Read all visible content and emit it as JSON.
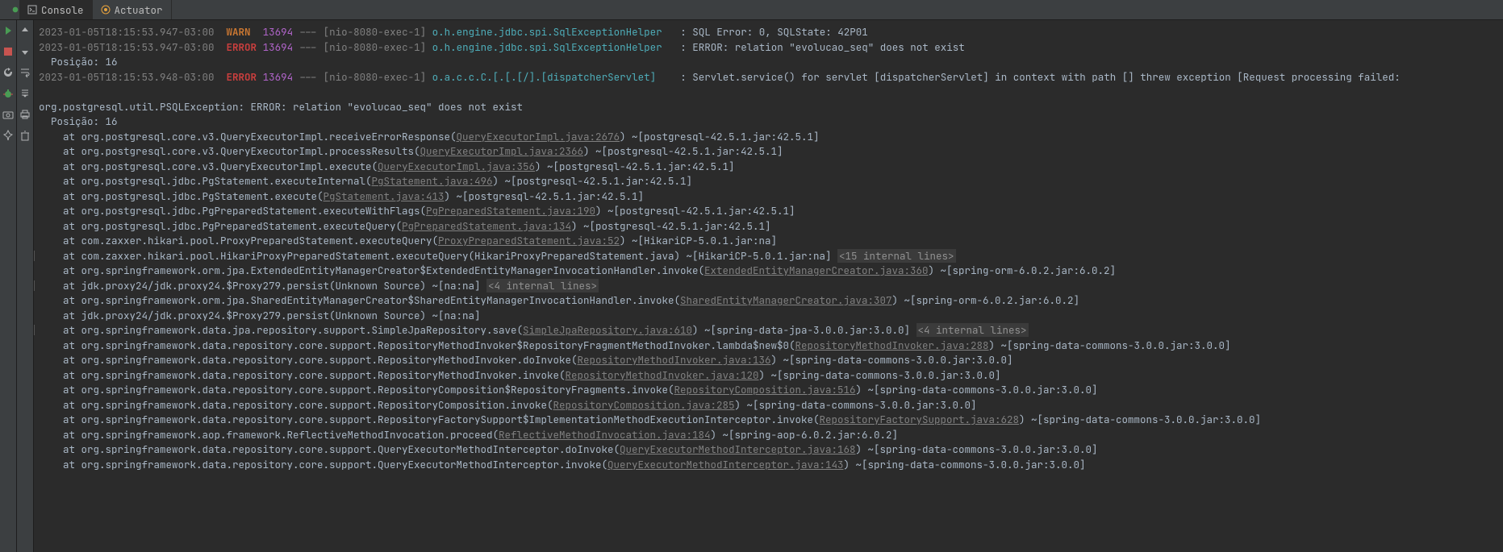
{
  "tabs": [
    {
      "label": "Console",
      "active": true,
      "icon": "terminal"
    },
    {
      "label": "Actuator",
      "active": false,
      "icon": "actuator"
    }
  ],
  "log": [
    {
      "type": "header",
      "ts": "2023-01-05T18:15:53.947-03:00",
      "level": "WARN",
      "levelClass": "warn",
      "pid": "13694",
      "thread": "[nio-8080-exec-1]",
      "logger": "o.h.engine.jdbc.spi.SqlExceptionHelper",
      "msg": ": SQL Error: 0, SQLState: 42P01"
    },
    {
      "type": "header",
      "ts": "2023-01-05T18:15:53.947-03:00",
      "level": "ERROR",
      "levelClass": "err",
      "pid": "13694",
      "thread": "[nio-8080-exec-1]",
      "logger": "o.h.engine.jdbc.spi.SqlExceptionHelper",
      "msg": ": ERROR: relation \"evolucao_seq\" does not exist"
    },
    {
      "type": "plain",
      "text": "  Posição: 16"
    },
    {
      "type": "header",
      "ts": "2023-01-05T18:15:53.948-03:00",
      "level": "ERROR",
      "levelClass": "err",
      "pid": "13694",
      "thread": "[nio-8080-exec-1]",
      "logger": "o.a.c.c.C.[.[.[/].[dispatcherServlet]",
      "msg": ": Servlet.service() for servlet [dispatcherServlet] in context with path [] threw exception [Request processing failed:"
    },
    {
      "type": "blank"
    },
    {
      "type": "plain",
      "text": "org.postgresql.util.PSQLException: ERROR: relation \"evolucao_seq\" does not exist"
    },
    {
      "type": "plain",
      "text": "  Posição: 16"
    },
    {
      "type": "trace",
      "pre": "    at org.postgresql.core.v3.QueryExecutorImpl.receiveErrorResponse(",
      "link": "QueryExecutorImpl.java:2676",
      "post": ") ~[postgresql-42.5.1.jar:42.5.1]"
    },
    {
      "type": "trace",
      "pre": "    at org.postgresql.core.v3.QueryExecutorImpl.processResults(",
      "link": "QueryExecutorImpl.java:2366",
      "post": ") ~[postgresql-42.5.1.jar:42.5.1]"
    },
    {
      "type": "trace",
      "pre": "    at org.postgresql.core.v3.QueryExecutorImpl.execute(",
      "link": "QueryExecutorImpl.java:356",
      "post": ") ~[postgresql-42.5.1.jar:42.5.1]"
    },
    {
      "type": "trace",
      "pre": "    at org.postgresql.jdbc.PgStatement.executeInternal(",
      "link": "PgStatement.java:496",
      "post": ") ~[postgresql-42.5.1.jar:42.5.1]"
    },
    {
      "type": "trace",
      "pre": "    at org.postgresql.jdbc.PgStatement.execute(",
      "link": "PgStatement.java:413",
      "post": ") ~[postgresql-42.5.1.jar:42.5.1]"
    },
    {
      "type": "trace",
      "pre": "    at org.postgresql.jdbc.PgPreparedStatement.executeWithFlags(",
      "link": "PgPreparedStatement.java:190",
      "post": ") ~[postgresql-42.5.1.jar:42.5.1]"
    },
    {
      "type": "trace",
      "pre": "    at org.postgresql.jdbc.PgPreparedStatement.executeQuery(",
      "link": "PgPreparedStatement.java:134",
      "post": ") ~[postgresql-42.5.1.jar:42.5.1]"
    },
    {
      "type": "trace",
      "pre": "    at com.zaxxer.hikari.pool.ProxyPreparedStatement.executeQuery(",
      "link": "ProxyPreparedStatement.java:52",
      "post": ") ~[HikariCP-5.0.1.jar:na]"
    },
    {
      "type": "trace",
      "fold": true,
      "pre": "    at com.zaxxer.hikari.pool.HikariProxyPreparedStatement.executeQuery(HikariProxyPreparedStatement.java) ~[HikariCP-5.0.1.jar:na] ",
      "internal": "<15 internal lines>"
    },
    {
      "type": "trace",
      "pre": "    at org.springframework.orm.jpa.ExtendedEntityManagerCreator$ExtendedEntityManagerInvocationHandler.invoke(",
      "link": "ExtendedEntityManagerCreator.java:360",
      "post": ") ~[spring-orm-6.0.2.jar:6.0.2]"
    },
    {
      "type": "trace",
      "fold": true,
      "pre": "    at jdk.proxy24/jdk.proxy24.$Proxy279.persist(Unknown Source) ~[na:na] ",
      "internal": "<4 internal lines>"
    },
    {
      "type": "trace",
      "pre": "    at org.springframework.orm.jpa.SharedEntityManagerCreator$SharedEntityManagerInvocationHandler.invoke(",
      "link": "SharedEntityManagerCreator.java:307",
      "post": ") ~[spring-orm-6.0.2.jar:6.0.2]"
    },
    {
      "type": "plain",
      "text": "    at jdk.proxy24/jdk.proxy24.$Proxy279.persist(Unknown Source) ~[na:na]"
    },
    {
      "type": "trace",
      "fold": true,
      "pre": "    at org.springframework.data.jpa.repository.support.SimpleJpaRepository.save(",
      "link": "SimpleJpaRepository.java:610",
      "post": ") ~[spring-data-jpa-3.0.0.jar:3.0.0] ",
      "internal": "<4 internal lines>"
    },
    {
      "type": "trace",
      "pre": "    at org.springframework.data.repository.core.support.RepositoryMethodInvoker$RepositoryFragmentMethodInvoker.lambda$new$0(",
      "link": "RepositoryMethodInvoker.java:288",
      "post": ") ~[spring-data-commons-3.0.0.jar:3.0.0]"
    },
    {
      "type": "trace",
      "pre": "    at org.springframework.data.repository.core.support.RepositoryMethodInvoker.doInvoke(",
      "link": "RepositoryMethodInvoker.java:136",
      "post": ") ~[spring-data-commons-3.0.0.jar:3.0.0]"
    },
    {
      "type": "trace",
      "pre": "    at org.springframework.data.repository.core.support.RepositoryMethodInvoker.invoke(",
      "link": "RepositoryMethodInvoker.java:120",
      "post": ") ~[spring-data-commons-3.0.0.jar:3.0.0]"
    },
    {
      "type": "trace",
      "pre": "    at org.springframework.data.repository.core.support.RepositoryComposition$RepositoryFragments.invoke(",
      "link": "RepositoryComposition.java:516",
      "post": ") ~[spring-data-commons-3.0.0.jar:3.0.0]"
    },
    {
      "type": "trace",
      "pre": "    at org.springframework.data.repository.core.support.RepositoryComposition.invoke(",
      "link": "RepositoryComposition.java:285",
      "post": ") ~[spring-data-commons-3.0.0.jar:3.0.0]"
    },
    {
      "type": "trace",
      "pre": "    at org.springframework.data.repository.core.support.RepositoryFactorySupport$ImplementationMethodExecutionInterceptor.invoke(",
      "link": "RepositoryFactorySupport.java:628",
      "post": ") ~[spring-data-commons-3.0.0.jar:3.0.0]"
    },
    {
      "type": "trace",
      "pre": "    at org.springframework.aop.framework.ReflectiveMethodInvocation.proceed(",
      "link": "ReflectiveMethodInvocation.java:184",
      "post": ") ~[spring-aop-6.0.2.jar:6.0.2]"
    },
    {
      "type": "trace",
      "pre": "    at org.springframework.data.repository.core.support.QueryExecutorMethodInterceptor.doInvoke(",
      "link": "QueryExecutorMethodInterceptor.java:168",
      "post": ") ~[spring-data-commons-3.0.0.jar:3.0.0]"
    },
    {
      "type": "trace",
      "pre": "    at org.springframework.data.repository.core.support.QueryExecutorMethodInterceptor.invoke(",
      "link": "QueryExecutorMethodInterceptor.java:143",
      "post": ") ~[spring-data-commons-3.0.0.jar:3.0.0]"
    }
  ],
  "icons": {
    "rerun": {
      "title": "Rerun"
    },
    "stop": {
      "title": "Stop"
    },
    "restart": {
      "title": "Restart"
    },
    "bug": {
      "title": "Bug"
    },
    "camera": {
      "title": "Dump"
    },
    "up": {
      "title": "Up Trace"
    },
    "down": {
      "title": "Down Trace"
    },
    "wrap": {
      "title": "Soft-Wrap"
    },
    "scroll": {
      "title": "Scroll to End"
    },
    "print": {
      "title": "Print"
    },
    "clear": {
      "title": "Clear All"
    },
    "pin": {
      "title": "Pin"
    }
  }
}
